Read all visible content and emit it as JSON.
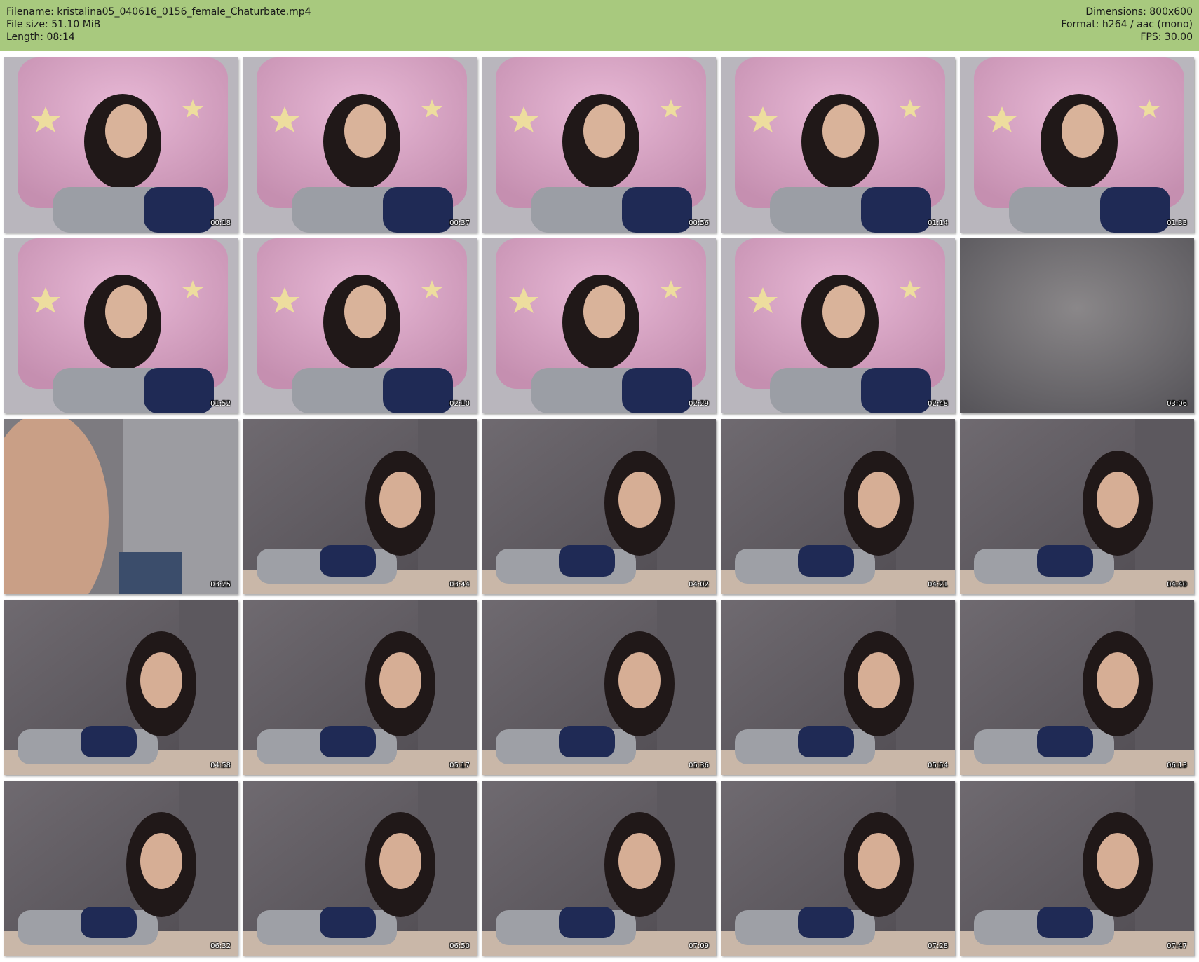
{
  "header": {
    "filename": "Filename: kristalina05_040616_0156_female_Chaturbate.mp4",
    "file_size": "File size: 51.10 MiB",
    "length": "Length: 08:14",
    "dimensions": "Dimensions: 800x600",
    "format": "Format: h264 / aac (mono)",
    "fps": "FPS: 30.00"
  },
  "colors": {
    "header_background": "#a8c97e",
    "page_background": "#ffffff"
  },
  "thumbnails": [
    {
      "time": "00:18",
      "scene": "pillow"
    },
    {
      "time": "00:37",
      "scene": "pillow"
    },
    {
      "time": "00:56",
      "scene": "pillow"
    },
    {
      "time": "01:14",
      "scene": "pillow"
    },
    {
      "time": "01:33",
      "scene": "pillow"
    },
    {
      "time": "01:52",
      "scene": "pillow"
    },
    {
      "time": "02:10",
      "scene": "pillow"
    },
    {
      "time": "02:29",
      "scene": "pillow"
    },
    {
      "time": "02:48",
      "scene": "pillow"
    },
    {
      "time": "03:06",
      "scene": "blank-wall"
    },
    {
      "time": "03:25",
      "scene": "closeup"
    },
    {
      "time": "03:44",
      "scene": "room"
    },
    {
      "time": "04:02",
      "scene": "room"
    },
    {
      "time": "04:21",
      "scene": "room"
    },
    {
      "time": "04:40",
      "scene": "room"
    },
    {
      "time": "04:58",
      "scene": "room"
    },
    {
      "time": "05:17",
      "scene": "room"
    },
    {
      "time": "05:36",
      "scene": "room"
    },
    {
      "time": "05:54",
      "scene": "room"
    },
    {
      "time": "06:13",
      "scene": "room"
    },
    {
      "time": "06:32",
      "scene": "room"
    },
    {
      "time": "06:50",
      "scene": "room"
    },
    {
      "time": "07:09",
      "scene": "room"
    },
    {
      "time": "07:28",
      "scene": "room"
    },
    {
      "time": "07:47",
      "scene": "room"
    }
  ]
}
